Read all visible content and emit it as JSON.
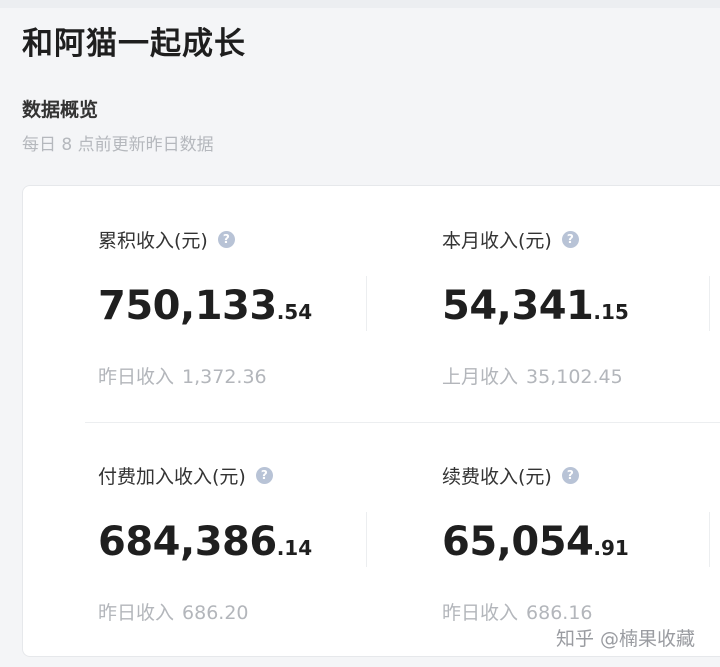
{
  "header": {
    "title": "和阿猫一起成长"
  },
  "overview": {
    "title": "数据概览",
    "subtitle": "每日 8 点前更新昨日数据"
  },
  "metrics": [
    {
      "label": "累积收入(元)",
      "value_int": "750,133",
      "value_dec": ".54",
      "sub_label": "昨日收入",
      "sub_value": "1,372.36"
    },
    {
      "label": "本月收入(元)",
      "value_int": "54,341",
      "value_dec": ".15",
      "sub_label": "上月收入",
      "sub_value": "35,102.45"
    },
    {
      "label": "付费加入收入(元)",
      "value_int": "684,386",
      "value_dec": ".14",
      "sub_label": "昨日收入",
      "sub_value": "686.20"
    },
    {
      "label": "续费收入(元)",
      "value_int": "65,054",
      "value_dec": ".91",
      "sub_label": "昨日收入",
      "sub_value": "686.16"
    }
  ],
  "icons": {
    "help": "question-circle-icon",
    "help_glyph": "?"
  },
  "watermark": "知乎 @楠果收藏",
  "colors": {
    "background": "#f4f5f7",
    "card": "#ffffff",
    "primary_text": "#1f1f1f",
    "muted_text": "#b3b6bb",
    "help_icon": "#b8c3d6"
  }
}
